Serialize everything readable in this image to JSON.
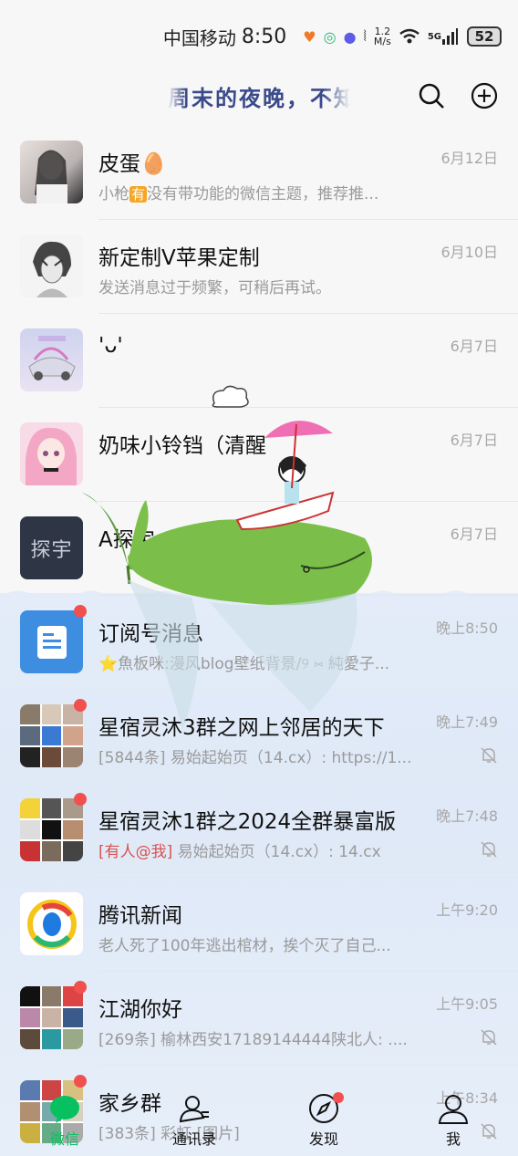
{
  "status_bar": {
    "carrier": "中国移动",
    "time": "8:50",
    "speed_value": "1.2",
    "speed_unit": "M/s",
    "network": "5G",
    "battery": "52"
  },
  "header": {
    "title": "周末的夜晚，不知"
  },
  "chats": [
    {
      "name": "皮蛋🥚",
      "preview_tag": "有",
      "preview_pre": "小枪",
      "preview": "没有带功能的微信主题，推荐推...",
      "time": "6月12日",
      "unread": false,
      "muted": false
    },
    {
      "name": "新定制V苹果定制",
      "preview": "发送消息过于频繁，可稍后再试。",
      "time": "6月10日",
      "unread": false,
      "muted": false
    },
    {
      "name": "'ᴗ'",
      "preview": "",
      "time": "6月7日",
      "unread": false,
      "muted": false
    },
    {
      "name": "奶味小铃铛（清醒",
      "preview": "",
      "time": "6月7日",
      "unread": false,
      "muted": false
    },
    {
      "name": "A探宇ᯤ⁹⁰⁰ᴳ",
      "preview": "",
      "time": "6月7日",
      "unread": false,
      "muted": false,
      "avatar_text": "探宇"
    },
    {
      "name": "订阅号消息",
      "preview": "⭐魚板咪:漫风blog壁纸背景/୨ ⑅ 純愛子...",
      "time": "晚上8:50",
      "unread": true,
      "muted": false
    },
    {
      "name": "星宿灵沐3群之网上邻居的天下",
      "preview": "[5844条] 易始起始页（14.cx）: https://1...",
      "time": "晚上7:49",
      "unread": true,
      "muted": true
    },
    {
      "name": "星宿灵沐1群之2024全群暴富版",
      "preview_at": "[有人@我]",
      "preview": " 易始起始页（14.cx）: 14.cx",
      "time": "晚上7:48",
      "unread": true,
      "muted": true
    },
    {
      "name": "腾讯新闻",
      "preview": "老人死了100年逃出棺材，挨个灭了自己...",
      "time": "上午9:20",
      "unread": false,
      "muted": false
    },
    {
      "name": "江湖你好",
      "preview": "[269条] 榆林西安17189144444陕北人: ....",
      "time": "上午9:05",
      "unread": true,
      "muted": true
    },
    {
      "name": "家乡群",
      "preview": "[383条] 彩虹 [图片]",
      "time": "上午8:34",
      "unread": true,
      "muted": true
    }
  ],
  "bottom_nav": [
    {
      "label": "微信",
      "icon": "chat-icon",
      "active": true
    },
    {
      "label": "通讯录",
      "icon": "contacts-icon",
      "active": false
    },
    {
      "label": "发现",
      "icon": "compass-icon",
      "active": false,
      "dot": true
    },
    {
      "label": "我",
      "icon": "person-icon",
      "active": false
    }
  ],
  "colors": {
    "accent": "#07c160",
    "badge": "#f1504f",
    "whale": "#7bbf4a"
  }
}
